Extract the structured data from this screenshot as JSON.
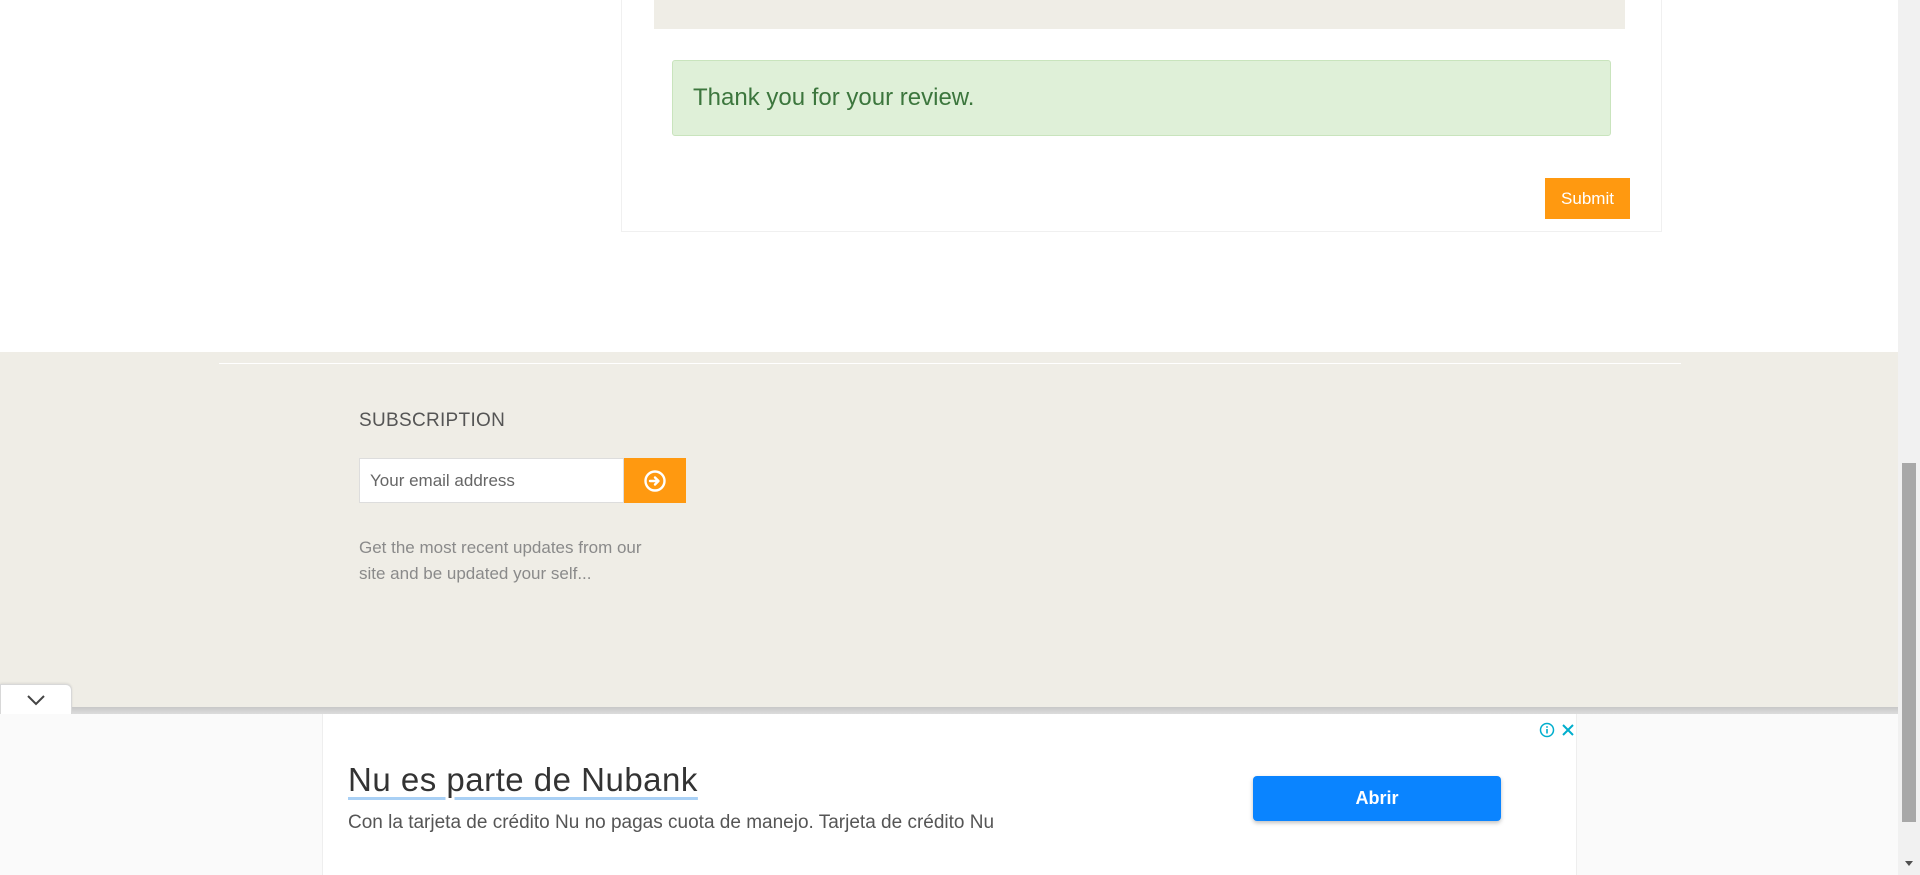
{
  "review": {
    "success_message": "Thank you for your review.",
    "submit_label": "Submit"
  },
  "footer": {
    "subscription_title": "SUBSCRIPTION",
    "email_placeholder": "Your email address",
    "description": "Get the most recent updates from our site and be updated your self..."
  },
  "ad": {
    "headline": "Nu es parte de Nubank",
    "body": "Con la tarjeta de crédito Nu no pagas cuota de manejo. Tarjeta de crédito Nu",
    "cta_label": "Abrir",
    "icons": [
      "info-icon",
      "close-icon",
      "chevron-down-icon"
    ]
  },
  "colors": {
    "accent_orange": "#ff9910",
    "success_bg": "#dff0d8",
    "success_text": "#3c763d",
    "footer_bg": "#efede6",
    "ad_cta_blue": "#0a84ff"
  }
}
